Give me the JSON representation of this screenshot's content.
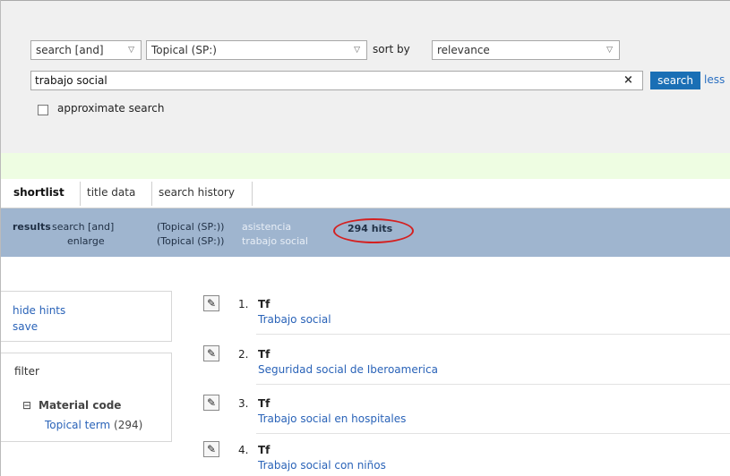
{
  "search": {
    "operator": "search [and]",
    "index": "Topical (SP:)",
    "sort_label": "sort by",
    "sort_value": "relevance",
    "query": "trabajo social",
    "clear_symbol": "×",
    "button": "search",
    "less_link": "less",
    "approximate_label": "approximate search"
  },
  "tabs": [
    "shortlist",
    "title data",
    "search history"
  ],
  "results_bar": {
    "label": "results",
    "row1_op": "search [and]",
    "row1_index": "(Topical (SP:))",
    "row1_term": "asistencia",
    "row2_op": "enlarge",
    "row2_index": "(Topical (SP:))",
    "row2_term": "trabajo social",
    "hits": "294 hits"
  },
  "sidebar": {
    "hide_hints": "hide hints",
    "save": "save",
    "filter": "filter",
    "material_toggle": "⊟",
    "material_title": "Material code",
    "material_term": "Topical term",
    "material_count": "(294)"
  },
  "results": [
    {
      "num": "1.",
      "type": "Tf",
      "title": "Trabajo social"
    },
    {
      "num": "2.",
      "type": "Tf",
      "title": "Seguridad social de Iberoamerica"
    },
    {
      "num": "3.",
      "type": "Tf",
      "title": "Trabajo social en hospitales"
    },
    {
      "num": "4.",
      "type": "Tf",
      "title": "Trabajo social con niños"
    }
  ],
  "colors": {
    "accent": "#1a6fb5",
    "results_bar": "#9fb5cf",
    "link": "#2a63b8",
    "hits_highlight": "#d42020",
    "green_band": "#eefde2"
  }
}
